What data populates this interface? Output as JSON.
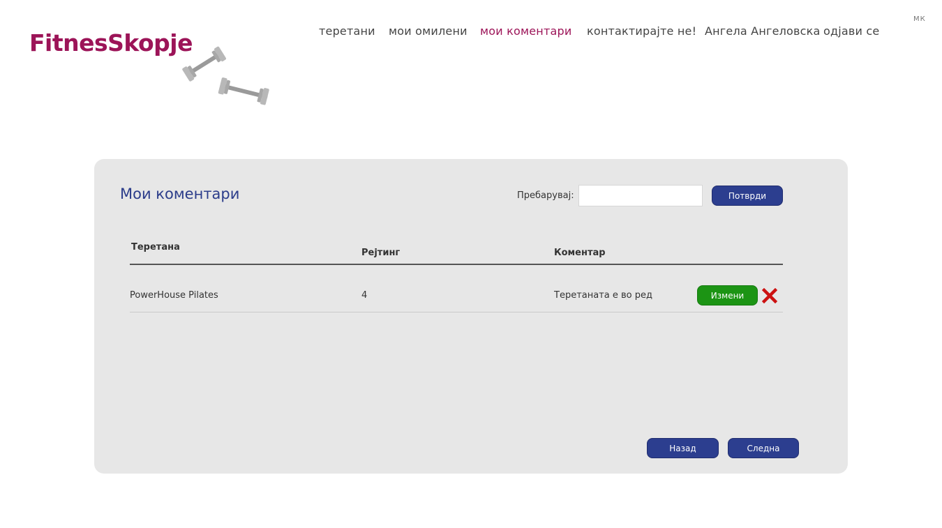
{
  "logo": {
    "text": "FitnesSkopje",
    "icon": "dumbbells-icon",
    "color": "#9c1458"
  },
  "nav": {
    "items": [
      {
        "label": "теретани"
      },
      {
        "label": "мои омилени"
      },
      {
        "label": "мои коментари",
        "active": true
      },
      {
        "label": "контактирајте не!"
      },
      {
        "label": "Ангела Ангеловска"
      },
      {
        "label": "одјави се"
      }
    ],
    "language": "мк"
  },
  "panel": {
    "title": "Мои коментари",
    "search": {
      "label": "Пребарувај:",
      "value": "",
      "placeholder": "",
      "button": "Потврди"
    },
    "table": {
      "headers": [
        "Теретана",
        "Рејтинг",
        "Коментар"
      ],
      "rows": [
        {
          "gym": "PowerHouse Pilates",
          "rating": "4",
          "comment": "Теретаната е во ред",
          "edit_label": "Измени",
          "delete_icon": "delete-x-icon"
        }
      ]
    },
    "pagination": {
      "back": "Назад",
      "next": "Следна"
    }
  },
  "colors": {
    "accent": "#9c1458",
    "primary": "#2c3e8f",
    "success": "#1c9414",
    "danger": "#cc1111",
    "panel_bg": "#e7e7e7"
  }
}
